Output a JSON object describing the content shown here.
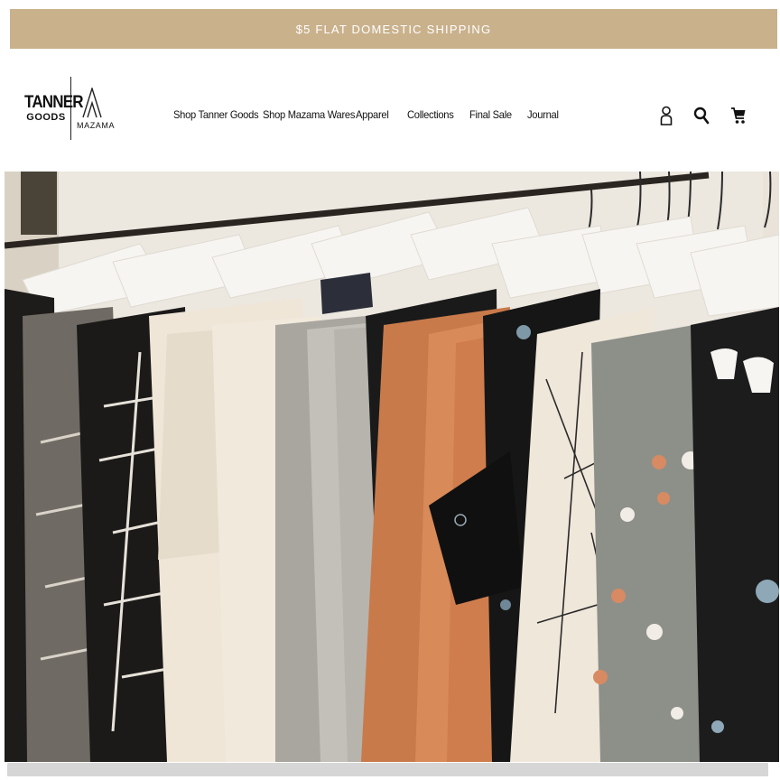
{
  "promo_banner": {
    "text": "$5 FLAT DOMESTIC SHIPPING"
  },
  "header": {
    "logo": {
      "brand_primary_line1": "TANNER",
      "brand_primary_line2": "GOODS",
      "brand_secondary": "MAZAMA"
    },
    "nav": [
      {
        "label": "Shop Tanner Goods"
      },
      {
        "label": "Shop Mazama Wares"
      },
      {
        "label": "Apparel"
      },
      {
        "label": "Collections"
      },
      {
        "label": "Final Sale"
      },
      {
        "label": "Journal"
      }
    ],
    "icons": [
      "account-icon",
      "search-icon",
      "cart-icon"
    ]
  },
  "hero": {
    "image": "clothing-rack-photo"
  },
  "colors": {
    "promo_background": "#c9b18c",
    "promo_text": "#ffffff",
    "text": "#111111"
  }
}
